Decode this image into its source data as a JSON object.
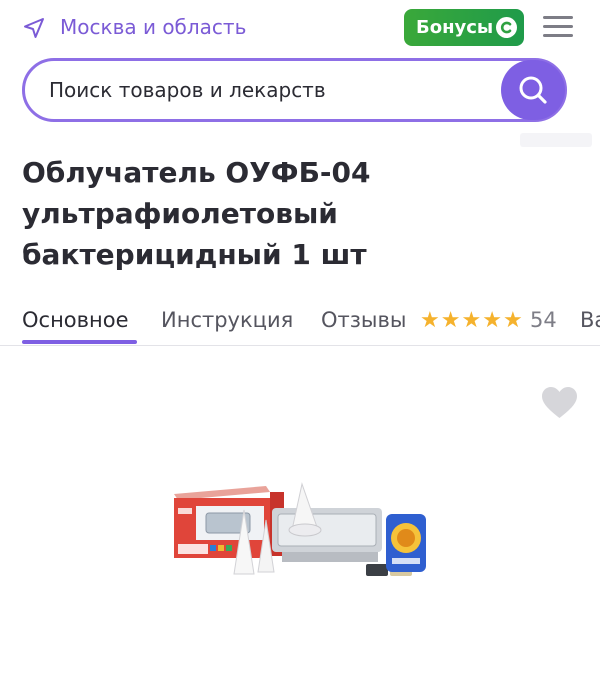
{
  "header": {
    "location": "Москва и область",
    "bonus_label": "Бонусы",
    "colors": {
      "accent": "#7e5fe3",
      "bonus": "#2fa141"
    }
  },
  "search": {
    "placeholder": "Поиск товаров и лекарств"
  },
  "product": {
    "title": "Облучатель ОУФБ-04 ультрафиолетовый бактерицидный 1 шт",
    "package_label": "ОУФБ-04"
  },
  "tabs": {
    "main": "Основное",
    "instruction": "Инструкция",
    "reviews": "Отзывы",
    "reviews_count": "54",
    "rating_stars": 5,
    "more_partial": "Ва"
  }
}
